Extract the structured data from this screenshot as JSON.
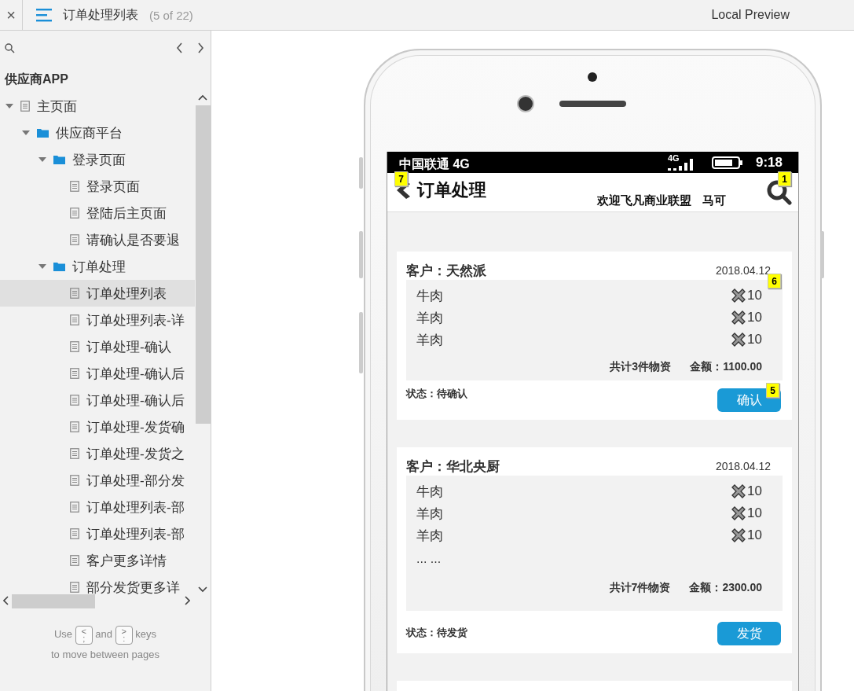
{
  "topbar": {
    "close": "×",
    "title": "订单处理列表",
    "page_count": "(5 of 22)",
    "preview": "Local Preview"
  },
  "sidebar": {
    "project": "供应商APP",
    "tree": [
      {
        "label": "主页面",
        "kind": "page",
        "expanded": true,
        "selected": false,
        "children": [
          {
            "label": "供应商平台",
            "kind": "folder",
            "expanded": true,
            "selected": false,
            "children": [
              {
                "label": "登录页面",
                "kind": "folder",
                "expanded": true,
                "selected": false,
                "children": [
                  {
                    "label": "登录页面",
                    "kind": "page",
                    "selected": false
                  },
                  {
                    "label": "登陆后主页面",
                    "kind": "page",
                    "selected": false
                  },
                  {
                    "label": "请确认是否要退",
                    "kind": "page",
                    "selected": false
                  }
                ]
              },
              {
                "label": "订单处理",
                "kind": "folder",
                "expanded": true,
                "selected": false,
                "children": [
                  {
                    "label": "订单处理列表",
                    "kind": "page",
                    "selected": true
                  },
                  {
                    "label": "订单处理列表-详",
                    "kind": "page",
                    "selected": false
                  },
                  {
                    "label": "订单处理-确认",
                    "kind": "page",
                    "selected": false
                  },
                  {
                    "label": "订单处理-确认后",
                    "kind": "page",
                    "selected": false
                  },
                  {
                    "label": "订单处理-确认后",
                    "kind": "page",
                    "selected": false
                  },
                  {
                    "label": "订单处理-发货确",
                    "kind": "page",
                    "selected": false
                  },
                  {
                    "label": "订单处理-发货之",
                    "kind": "page",
                    "selected": false
                  },
                  {
                    "label": "订单处理-部分发",
                    "kind": "page",
                    "selected": false
                  },
                  {
                    "label": "订单处理列表-部",
                    "kind": "page",
                    "selected": false
                  },
                  {
                    "label": "订单处理列表-部",
                    "kind": "page",
                    "selected": false
                  },
                  {
                    "label": "客户更多详情",
                    "kind": "page",
                    "selected": false
                  },
                  {
                    "label": "部分发货更多详",
                    "kind": "page",
                    "selected": false
                  }
                ]
              }
            ]
          }
        ]
      }
    ],
    "footer": {
      "use": "Use",
      "key_prev": {
        "top": "<",
        "bottom": ";"
      },
      "and": "and",
      "key_next": {
        "top": ">",
        "bottom": ":"
      },
      "keys": "keys",
      "line2": "to move between pages"
    }
  },
  "phone": {
    "status_bar": {
      "carrier": "中国联通 4G",
      "network": "4G",
      "time": "9:18"
    },
    "header": {
      "title": "订单处理",
      "welcome": "欢迎飞凡商业联盟",
      "user": "马可"
    },
    "orders": [
      {
        "customer": "客户：天然派",
        "date": "2018.04.12",
        "items": [
          {
            "name": "牛肉",
            "qty": "10"
          },
          {
            "name": "羊肉",
            "qty": "10"
          },
          {
            "name": "羊肉",
            "qty": "10"
          }
        ],
        "total": "共计3件物资",
        "amount": "金额：1100.00",
        "status": "状态：待确认",
        "action": "确认"
      },
      {
        "customer": "客户：华北央厨",
        "date": "2018.04.12",
        "items": [
          {
            "name": "牛肉",
            "qty": "10"
          },
          {
            "name": "羊肉",
            "qty": "10"
          },
          {
            "name": "羊肉",
            "qty": "10"
          }
        ],
        "more": "... ...",
        "total": "共计7件物资",
        "amount": "金额：2300.00",
        "status": "状态：待发货",
        "action": "发货"
      }
    ],
    "markers": [
      "7",
      "1",
      "6",
      "5"
    ]
  }
}
